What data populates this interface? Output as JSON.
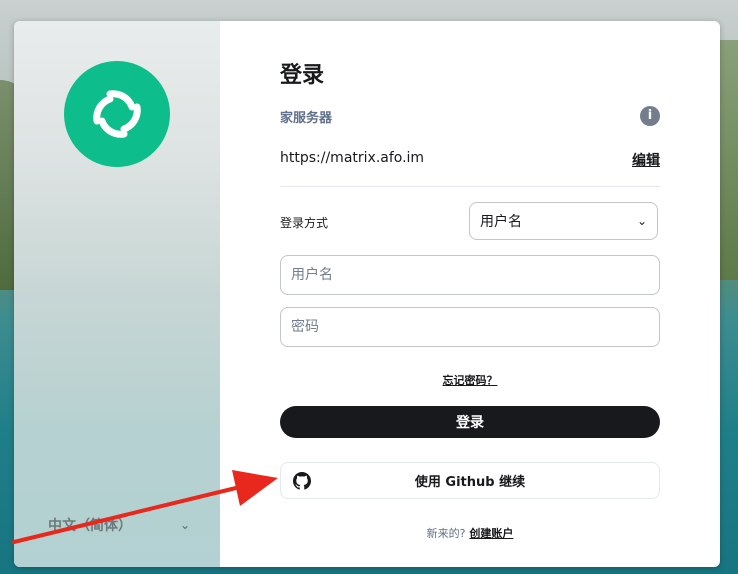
{
  "login": {
    "title": "登录",
    "homeserver_label": "家服务器",
    "homeserver_url": "https://matrix.afo.im",
    "edit_label": "编辑",
    "info_glyph": "i",
    "method_label": "登录方式",
    "method_value": "用户名",
    "username_placeholder": "用户名",
    "password_placeholder": "密码",
    "forgot_label": "忘记密码？",
    "login_button": "登录",
    "sso_button": "使用 Github 继续",
    "new_prompt": "新来的?",
    "create_account": "创建账户"
  },
  "language": {
    "selected": "中文（简体）"
  },
  "icons": {
    "logo": "element-logo-icon",
    "info": "info-icon",
    "chevron": "chevron-down-icon",
    "github": "github-icon",
    "annotation": "red-arrow"
  },
  "colors": {
    "brand": "#0dbd8b",
    "primary_button": "#17191c",
    "annotation_arrow": "#e8281c"
  }
}
